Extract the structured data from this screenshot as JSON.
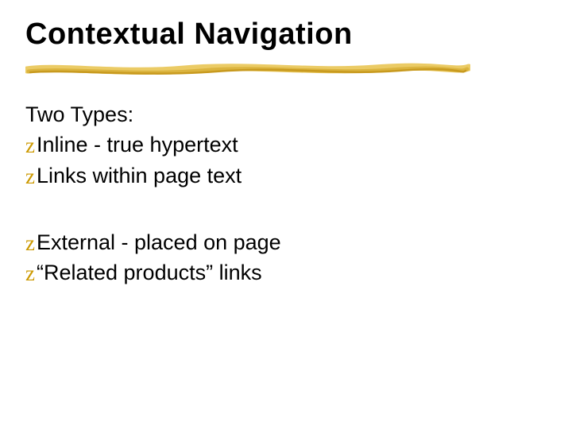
{
  "title": "Contextual Navigation",
  "bullet_glyph": "z",
  "subheading": "Two Types:",
  "group1": {
    "items": [
      "Inline - true hypertext",
      "Links within page text"
    ]
  },
  "group2": {
    "items": [
      "External - placed on page",
      "“Related products” links"
    ]
  },
  "colors": {
    "accent": "#d9b13b",
    "accent_dark": "#c89a1f"
  }
}
